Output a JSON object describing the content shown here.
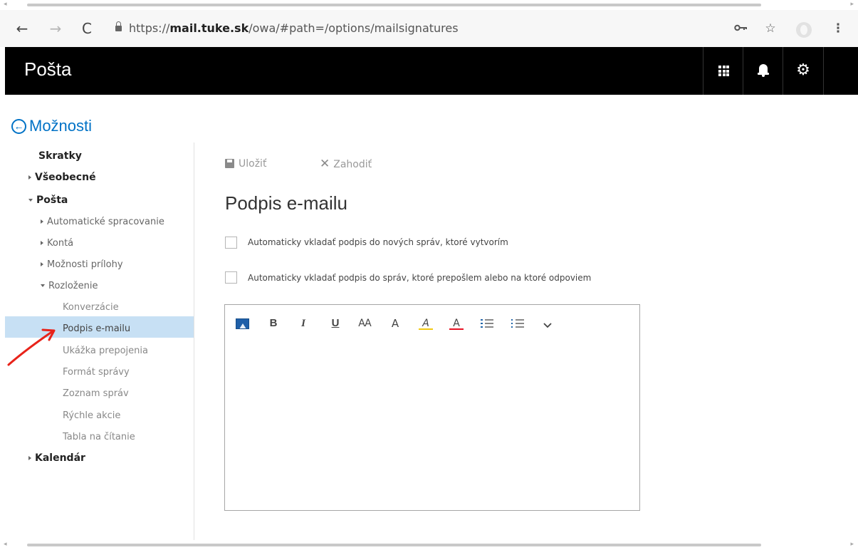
{
  "browser": {
    "url_scheme": "https://",
    "url_host": "mail.tuke.sk",
    "url_path": "/owa/#path=/options/mailsignatures"
  },
  "app": {
    "title": "Pošta"
  },
  "nav": {
    "back_label": "Možnosti",
    "shortcuts": "Skratky",
    "general": "Všeobecné",
    "mail": "Pošta",
    "auto_processing": "Automatické spracovanie",
    "accounts": "Kontá",
    "attachment_options": "Možnosti prílohy",
    "layout": "Rozloženie",
    "layout_items": [
      "Konverzácie",
      "Podpis e-mailu",
      "Ukážka prepojenia",
      "Formát správy",
      "Zoznam správ",
      "Rýchle akcie",
      "Tabla na čítanie"
    ],
    "calendar": "Kalendár",
    "selected": "Podpis e-mailu"
  },
  "commands": {
    "save": "Uložiť",
    "discard": "Zahodiť"
  },
  "page": {
    "heading": "Podpis e-mailu",
    "checkbox_new": "Automaticky vkladať podpis do nových správ, ktoré vytvorím",
    "checkbox_reply": "Automaticky vkladať podpis do správ, ktoré prepošlem alebo na ktoré odpoviem",
    "checkbox_new_checked": false,
    "checkbox_reply_checked": false
  },
  "editor_toolbar": {
    "bold": "B",
    "italic": "I",
    "underline": "U",
    "font_size": "AA",
    "grow": "A",
    "highlight": "A",
    "font_color": "A",
    "chevron": "⌄"
  },
  "colors": {
    "accent": "#0072c6",
    "header_bg": "#000000",
    "selected_bg": "#c7e0f4",
    "annotation": "#e8231a",
    "highlight_yellow": "#f2c811",
    "font_red": "#e81123"
  }
}
